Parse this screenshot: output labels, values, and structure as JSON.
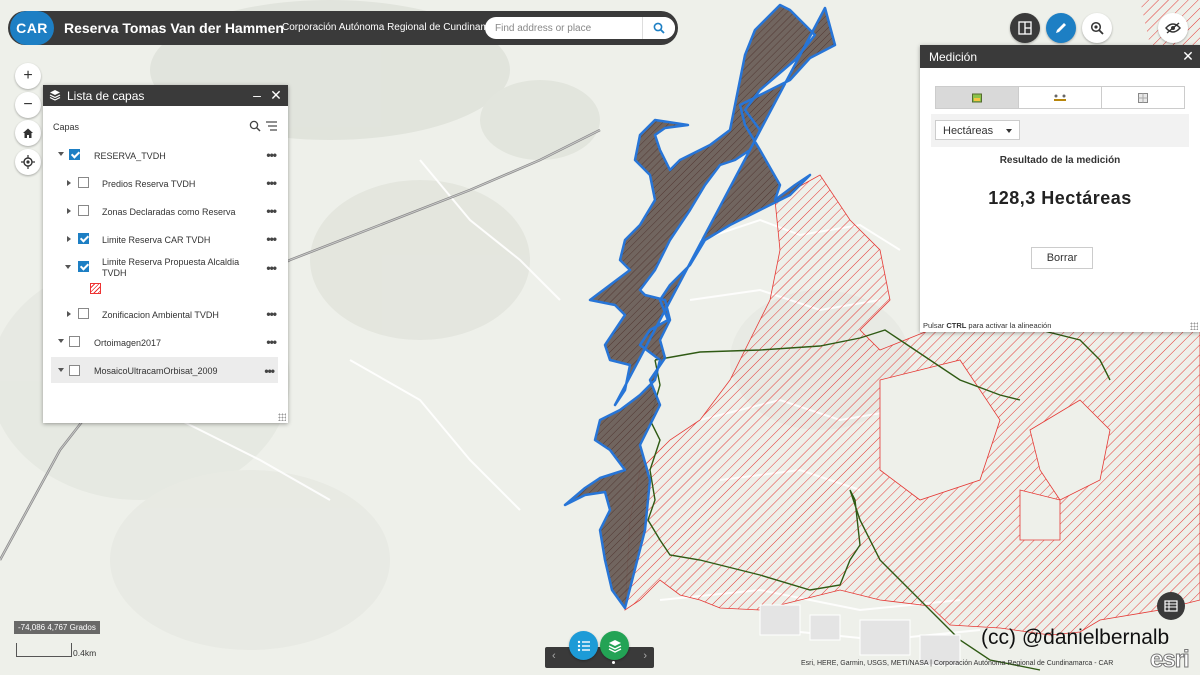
{
  "header": {
    "logo_text": "CAR",
    "title": "Reserva Tomas Van der Hammen",
    "subtitle": "Corporación Autónoma Regional de Cundinamarca",
    "search_placeholder": "Find address or place"
  },
  "map_tools": [
    {
      "name": "zoom-in-button",
      "glyph": "+"
    },
    {
      "name": "zoom-out-button",
      "glyph": "−"
    },
    {
      "name": "home-button",
      "icon": "home-icon"
    },
    {
      "name": "locate-button",
      "icon": "locate-icon"
    }
  ],
  "layer_list": {
    "title": "Lista de capas",
    "section_label": "Capas",
    "layers": [
      {
        "label": "RESERVA_TVDH",
        "checked": true,
        "expanded": true,
        "level": 0
      },
      {
        "label": "Predios Reserva TVDH",
        "checked": false,
        "expanded": false,
        "level": 1
      },
      {
        "label": "Zonas Declaradas como Reserva",
        "checked": false,
        "expanded": false,
        "level": 1
      },
      {
        "label": "Limite Reserva CAR TVDH",
        "checked": true,
        "expanded": false,
        "level": 1
      },
      {
        "label": "Limite Reserva Propuesta Alcaldia",
        "label2": "TVDH",
        "checked": true,
        "expanded": true,
        "level": 1
      },
      {
        "label": "Zonificacion Ambiental TVDH",
        "checked": false,
        "expanded": false,
        "level": 1
      },
      {
        "label": "Ortoimagen2017",
        "checked": false,
        "expanded": true,
        "level": 0
      },
      {
        "label": "MosaicoUltracamOrbisat_2009",
        "checked": false,
        "expanded": true,
        "level": 0
      }
    ]
  },
  "measure_panel": {
    "title": "Medición",
    "tabs": [
      "area-tool",
      "distance-tool",
      "location-tool"
    ],
    "units": "Hectáreas",
    "result_label": "Resultado de la medición",
    "result_value": "128,3 Hectáreas",
    "clear_label": "Borrar",
    "hint_prefix": "Pulsar ",
    "hint_key": "CTRL",
    "hint_suffix": " para activar la alineación"
  },
  "status": {
    "coordinates": "-74,086 4,767 Grados",
    "scale_label": "0.4km"
  },
  "watermark": "(cc) @danielbernalb",
  "attribution": "Esri, HERE, Garmin, USGS, METI/NASA | Corporación Autónoma Regional de Cundinamarca - CAR",
  "esri_logo": "esri",
  "colors": {
    "header_bg": "#3a3a3a",
    "accent": "#1d7fc4",
    "reserve_fill": "#6b5e58",
    "reserve_outline": "#1d6fd6",
    "proposal_hatch": "#e53935",
    "boundary_line": "#2f5a14"
  }
}
